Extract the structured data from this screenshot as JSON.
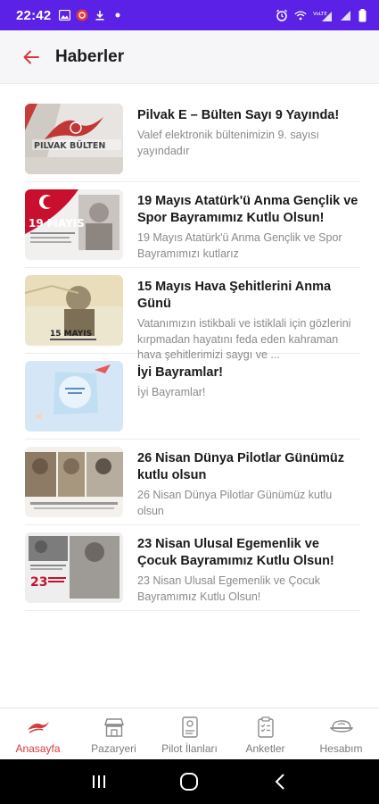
{
  "status_bar": {
    "time": "22:42",
    "left_icons": [
      "image-icon",
      "record-icon",
      "download-icon",
      "dot-icon"
    ],
    "right_icons": [
      "alarm-icon",
      "wifi-icon",
      "volte-signal-icon",
      "signal-icon",
      "battery-icon"
    ]
  },
  "header": {
    "title": "Haberler",
    "back_icon": "arrow-left-icon"
  },
  "news": [
    {
      "title": "Pilvak E – Bülten Sayı 9 Yayında!",
      "subtitle": "Valef elektronik bültenimizin 9. sayısı yayındadır",
      "thumb_text": "PILVAK BÜLTEN"
    },
    {
      "title": "19 Mayıs Atatürk'ü Anma Gençlik ve Spor Bayramımız Kutlu Olsun!",
      "subtitle": "19 Mayıs Atatürk'ü Anma Gençlik ve Spor Bayramımızı kutlarız",
      "thumb_text": "19 MAYIS"
    },
    {
      "title": "15 Mayıs Hava Şehitlerini Anma Günü",
      "subtitle": "Vatanımızın istikbali ve istiklali için gözlerini kırpmadan hayatını feda eden kahraman hava şehitlerimizi saygı ve ...",
      "thumb_text": "15 MAYIS"
    },
    {
      "title": "İyi Bayramlar!",
      "subtitle": "İyi Bayramlar!",
      "thumb_text": ""
    },
    {
      "title": "26 Nisan Dünya Pilotlar Günümüz kutlu olsun",
      "subtitle": "26 Nisan Dünya Pilotlar Günümüz kutlu olsun",
      "thumb_text": ""
    },
    {
      "title": "23 Nisan Ulusal Egemenlik ve Çocuk Bayramımız Kutlu Olsun!",
      "subtitle": "23 Nisan Ulusal Egemenlik ve Çocuk Bayramımız Kutlu Olsun!",
      "thumb_text": "23"
    }
  ],
  "bottom_nav": [
    {
      "label": "Anasayfa",
      "icon": "plane-logo-icon",
      "active": true
    },
    {
      "label": "Pazaryeri",
      "icon": "store-icon",
      "active": false
    },
    {
      "label": "Pilot İlanları",
      "icon": "document-icon",
      "active": false
    },
    {
      "label": "Anketler",
      "icon": "clipboard-icon",
      "active": false
    },
    {
      "label": "Hesabım",
      "icon": "pilot-cap-icon",
      "active": false
    }
  ],
  "colors": {
    "status_bar": "#5b21e6",
    "accent": "#d63a3a",
    "title_text": "#1a1a1a",
    "subtitle_text": "#8a8a8a"
  },
  "system_nav": [
    "recent-apps-icon",
    "home-icon",
    "back-icon"
  ]
}
